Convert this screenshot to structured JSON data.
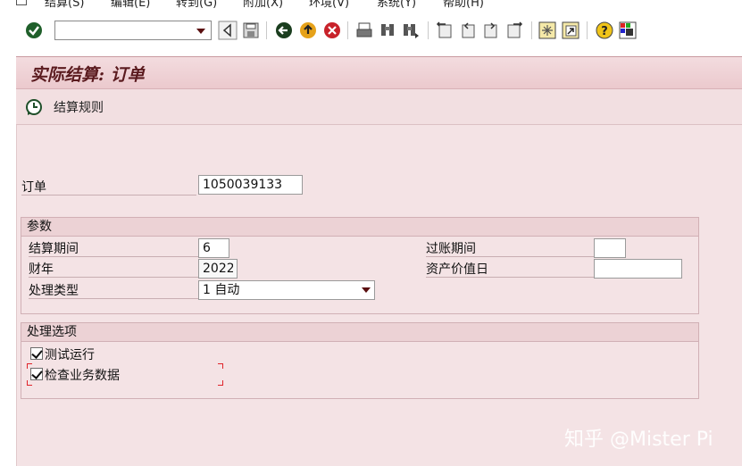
{
  "menu": {
    "items": [
      "结算(S)",
      "编辑(E)",
      "转到(G)",
      "附加(X)",
      "环境(V)",
      "系统(Y)",
      "帮助(H)"
    ]
  },
  "toolbar": {
    "command_value": "",
    "icons": [
      "check-icon",
      "back-arrow-icon",
      "save-icon",
      "back-icon",
      "exit-icon",
      "cancel-icon",
      "print-icon",
      "find-icon",
      "find-next-icon",
      "first-page-icon",
      "previous-page-icon",
      "next-page-icon",
      "last-page-icon",
      "new-session-icon",
      "shortcut-icon",
      "help-icon",
      "customize-layout-icon"
    ]
  },
  "title": "实际结算: 订单",
  "app_toolbar": {
    "rules_button_label": "结算规则"
  },
  "order": {
    "label": "订单",
    "value": "1050039133"
  },
  "params": {
    "header": "参数",
    "settlement_period_label": "结算期间",
    "settlement_period_value": "6",
    "fiscal_year_label": "财年",
    "fiscal_year_value": "2022",
    "processing_type_label": "处理类型",
    "processing_type_value": "1 自动",
    "posting_period_label": "过账期间",
    "posting_period_value": "",
    "asset_value_date_label": "资产价值日",
    "asset_value_date_value": ""
  },
  "options": {
    "header": "处理选项",
    "test_run_label": "测试运行",
    "test_run_checked": true,
    "check_trans_label": "检查业务数据",
    "check_trans_checked": true
  },
  "watermark": "知乎 @Mister Pi",
  "colors": {
    "title_bg": "#ebc9cd",
    "main_bg": "#f4e3e5",
    "title_text": "#5a1a1e"
  }
}
